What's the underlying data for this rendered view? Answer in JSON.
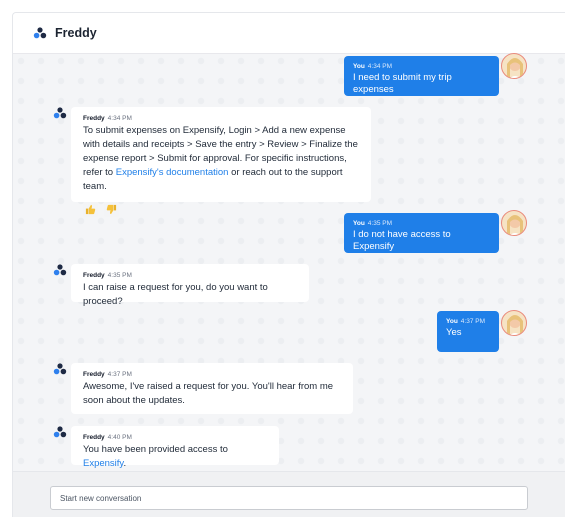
{
  "header": {
    "title": "Freddy"
  },
  "messages": [
    {
      "sender": "You",
      "time": "4:34 PM",
      "text": "I need to submit my trip expenses"
    },
    {
      "sender": "Freddy",
      "time": "4:34 PM",
      "text_before": "To submit expenses on Expensify, Login > Add a new expense with details and receipts > Save the entry > Review > Finalize the expense report > Submit for approval. For specific instructions, refer to ",
      "link": "Expensify's documentation",
      "text_after": " or reach out to the support team."
    },
    {
      "sender": "You",
      "time": "4:35 PM",
      "text": "I do not have access to Expensify"
    },
    {
      "sender": "Freddy",
      "time": "4:35 PM",
      "text": "I can raise a request for you, do you want to proceed?"
    },
    {
      "sender": "You",
      "time": "4:37 PM",
      "text": "Yes"
    },
    {
      "sender": "Freddy",
      "time": "4:37 PM",
      "text": "Awesome, I've raised a request for you. You'll hear from me soon about the updates."
    },
    {
      "sender": "Freddy",
      "time": "4:40 PM",
      "text_before": "You have been provided access to ",
      "link": "Expensify",
      "text_after": "."
    }
  ],
  "feedback": {
    "thumbs_up_icon": "thumbs-up-icon",
    "thumbs_down_icon": "thumbs-down-icon"
  },
  "composer": {
    "placeholder": "Start new conversation"
  },
  "colors": {
    "accent": "#1f7fe8",
    "bot_logo": "#1e2a44",
    "bot_logo_accent": "#2f80ed"
  }
}
